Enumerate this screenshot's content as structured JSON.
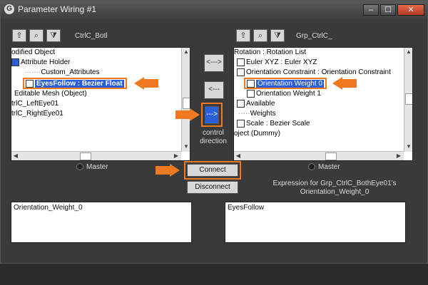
{
  "window": {
    "title": "Parameter Wiring #1",
    "icon_glyph": "G",
    "controls": {
      "minimize": "–",
      "maximize": "☐",
      "close": "✕"
    }
  },
  "left_panel": {
    "label": "CtrlC_Botl",
    "toolbar": [
      {
        "icon": "folder-up-icon",
        "glyph": "⇪"
      },
      {
        "icon": "binoculars-icon",
        "glyph": "⌕"
      },
      {
        "icon": "filter-icon",
        "glyph": "⧩"
      }
    ],
    "tree": [
      {
        "text": "odified Object"
      },
      {
        "text": "Attribute Holder"
      },
      {
        "text": "Custom_Attributes"
      },
      {
        "text": "EyesFollow : Bezier Float"
      },
      {
        "text": "Editable Mesh (Object)"
      },
      {
        "text": "trlC_LeftEye01"
      },
      {
        "text": "trlC_RightEye01"
      }
    ],
    "master_label": "Master"
  },
  "right_panel": {
    "label": "Grp_CtrlC_",
    "toolbar": [
      {
        "icon": "folder-up-icon",
        "glyph": "⇪"
      },
      {
        "icon": "binoculars-icon",
        "glyph": "⌕"
      },
      {
        "icon": "filter-icon",
        "glyph": "⧩"
      }
    ],
    "tree": [
      {
        "text": "Rotation : Rotation List"
      },
      {
        "text": "Euler XYZ : Euler XYZ"
      },
      {
        "text": "Orientation Constraint : Orientation Constraint"
      },
      {
        "text": "Orientation Weight 0"
      },
      {
        "text": "Orientation Weight 1"
      },
      {
        "text": "Available"
      },
      {
        "text": "Weights"
      },
      {
        "text": "Scale : Bezier Scale"
      },
      {
        "text": "oject (Dummy)"
      }
    ],
    "master_label": "Master"
  },
  "middle": {
    "left_to_right": "<--->",
    "right_to_left": "<---",
    "control_direction": "--->",
    "control_direction_label": "control direction"
  },
  "actions": {
    "connect": "Connect",
    "disconnect": "Disconnect"
  },
  "expression": {
    "heading": "Expression for Grp_CtrlC_BothEye01's Orientation_Weight_0",
    "left_text": "Orientation_Weight_0",
    "right_text": "EyesFollow"
  },
  "colors": {
    "highlight": "#2a5fd6",
    "callout_orange": "#f07820"
  }
}
